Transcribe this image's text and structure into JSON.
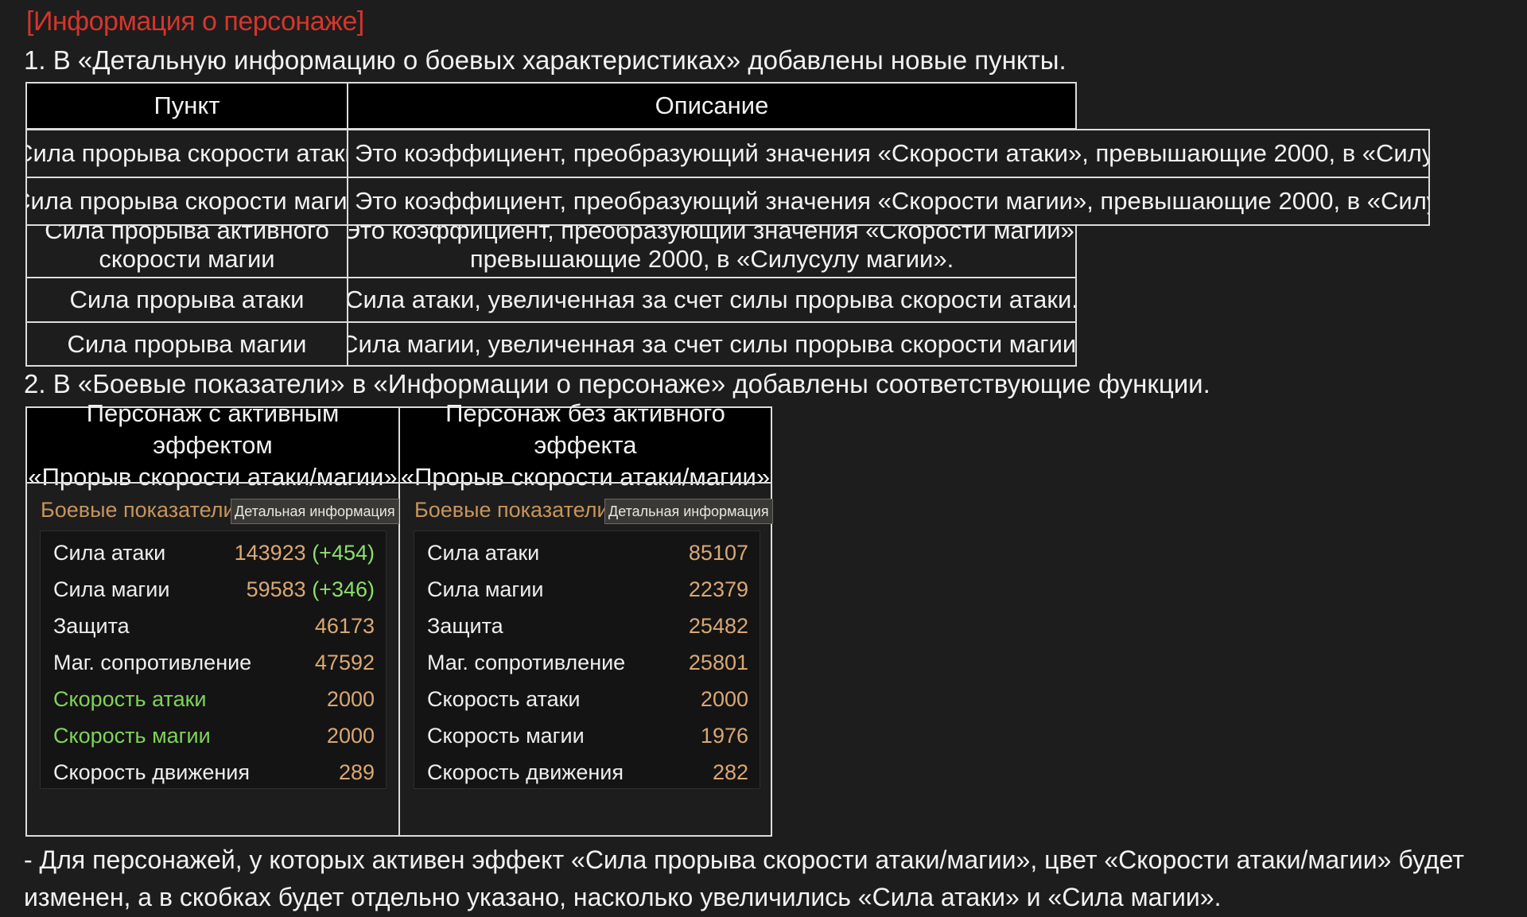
{
  "section_title": "[Информация о персонаже]",
  "point1": "1. В «Детальную информацию о боевых характеристиках» добавлены новые пункты.",
  "table1": {
    "header_item": "Пункт",
    "header_desc": "Описание",
    "rows": [
      {
        "item": "Сила прорыва скорости атаки",
        "desc": "Это коэффициент, преобразующий значения «Скорости атаки», превышающие 2000, в «Силу атаки»."
      },
      {
        "item": "Сила прорыва скорости магии",
        "desc": "Это коэффициент, преобразующий значения «Скорости магии», превышающие 2000, в «Силу магии»."
      },
      {
        "item_line1": "Сила прорыва активного",
        "item_line2": "скорости магии",
        "desc_line1": "Это коэффициент, преобразующий значения «Скорости магии»,",
        "desc_line2": "превышающие 2000, в «Силусулу магии»."
      },
      {
        "item": "Сила прорыва атаки",
        "desc": "Сила атаки, увеличенная за счет силы прорыва скорости атаки."
      },
      {
        "item": "Сила прорыва магии",
        "desc": "Сила магии, увеличенная за счет силы прорыва скорости магии."
      }
    ]
  },
  "point2": "2. В «Боевые показатели» в «Информации о персонаже» добавлены соответствующие функции.",
  "table2": {
    "left_header_line1": "Персонаж с активным эффектом",
    "left_header_line2": "«Прорыв скорости атаки/магии»",
    "right_header_line1": "Персонаж без активного эффекта",
    "right_header_line2": "«Прорыв скорости атаки/магии»",
    "panel_title": "Боевые показатели",
    "detail_button": "Детальная информация",
    "left_stats": [
      {
        "label": "Сила атаки",
        "value": "143923",
        "bonus": "(+454)"
      },
      {
        "label": "Сила магии",
        "value": "59583",
        "bonus": "(+346)"
      },
      {
        "label": "Защита",
        "value": "46173",
        "bonus": ""
      },
      {
        "label": "Маг. сопротивление",
        "value": "47592",
        "bonus": ""
      },
      {
        "label": "Скорость атаки",
        "value": "2000",
        "bonus": ""
      },
      {
        "label": "Скорость магии",
        "value": "2000",
        "bonus": ""
      },
      {
        "label": "Скорость движения",
        "value": "289",
        "bonus": ""
      }
    ],
    "right_stats": [
      {
        "label": "Сила атаки",
        "value": "85107"
      },
      {
        "label": "Сила магии",
        "value": "22379"
      },
      {
        "label": "Защита",
        "value": "25482"
      },
      {
        "label": "Маг. сопротивление",
        "value": "25801"
      },
      {
        "label": "Скорость атаки",
        "value": "2000"
      },
      {
        "label": "Скорость магии",
        "value": "1976"
      },
      {
        "label": "Скорость движения",
        "value": "282"
      }
    ]
  },
  "footnote": "- Для персонажей, у которых активен эффект «Сила прорыва скорости атаки/магии», цвет «Скорости атаки/магии» будет изменен, а в скобках будет отдельно указано, насколько увеличились «Сила атаки» и «Сила магии».",
  "colors": {
    "title_red": "#d6352a",
    "stat_label_orange": "#c8955b",
    "value_tan": "#d9a874",
    "bonus_green": "#8be06b",
    "highlight_green": "#7fd35a"
  }
}
